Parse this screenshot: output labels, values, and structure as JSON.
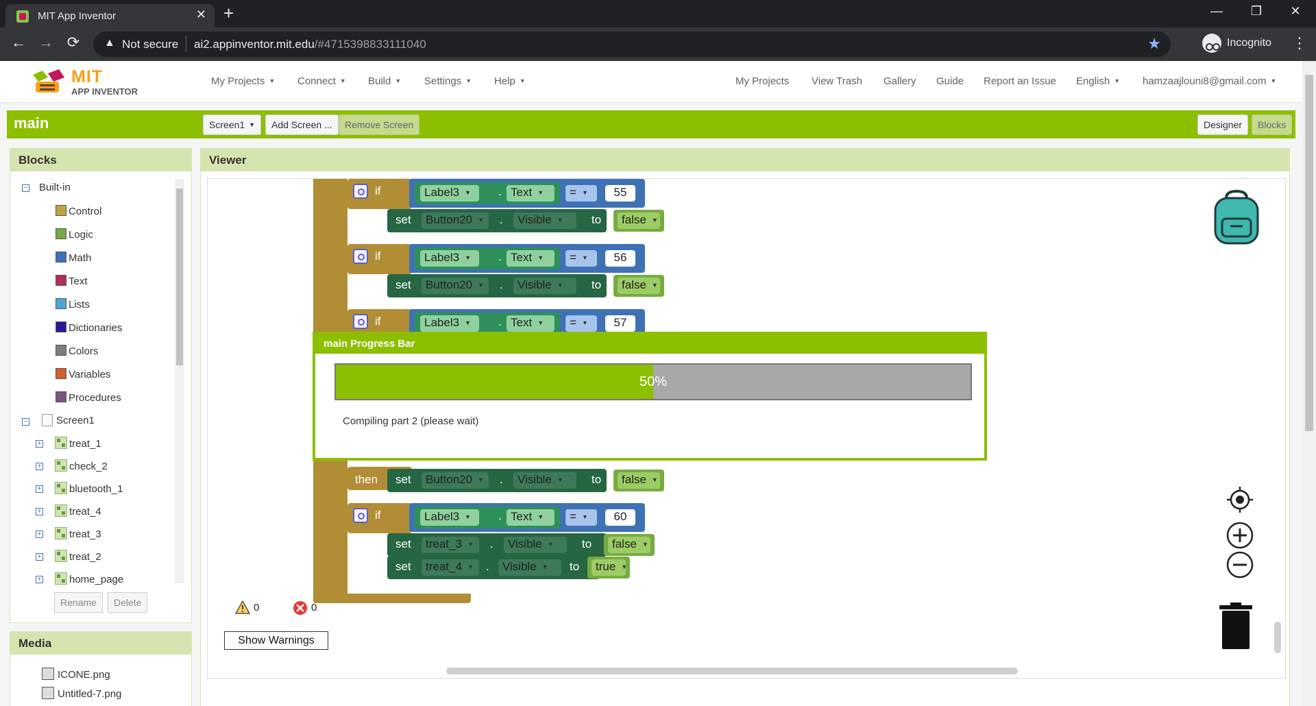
{
  "browser": {
    "tab_title": "MIT App Inventor",
    "tab_close": "✕",
    "new_tab": "+",
    "security_label": "Not secure",
    "url_host": "ai2.appinventor.mit.edu",
    "url_rest": "/#4715398833111040",
    "profile_label": "Incognito",
    "window_controls": [
      "—",
      "❐",
      "✕"
    ],
    "nav": [
      "←",
      "→",
      "⟳"
    ]
  },
  "appnav": {
    "logo_mit": "MIT",
    "logo_sub": "APP INVENTOR",
    "left_menus": [
      "My Projects",
      "Connect",
      "Build",
      "Settings",
      "Help"
    ],
    "right_links": [
      "My Projects",
      "View Trash",
      "Gallery",
      "Guide",
      "Report an Issue",
      "English",
      "hamzaajlouni8@gmail.com"
    ]
  },
  "project_bar": {
    "name": "main",
    "screen_select": "Screen1",
    "add_screen": "Add Screen ...",
    "remove_screen": "Remove Screen",
    "designer": "Designer",
    "blocks": "Blocks"
  },
  "blocks_panel": {
    "title": "Blocks",
    "builtin_label": "Built-in",
    "builtin": [
      {
        "label": "Control",
        "color": "#c0a048"
      },
      {
        "label": "Logic",
        "color": "#77ab41"
      },
      {
        "label": "Math",
        "color": "#3f71b5"
      },
      {
        "label": "Text",
        "color": "#b32d5e"
      },
      {
        "label": "Lists",
        "color": "#49a6d4"
      },
      {
        "label": "Dictionaries",
        "color": "#2d1799"
      },
      {
        "label": "Colors",
        "color": "#7d7d7d"
      },
      {
        "label": "Variables",
        "color": "#d05f2d"
      },
      {
        "label": "Procedures",
        "color": "#7c5385"
      }
    ],
    "screen_label": "Screen1",
    "components": [
      "treat_1",
      "check_2",
      "bluetooth_1",
      "treat_4",
      "treat_3",
      "treat_2",
      "home_page"
    ],
    "rename": "Rename",
    "delete": "Delete"
  },
  "media_panel": {
    "title": "Media",
    "files": [
      "ICONE.png",
      "Untitled-7.png"
    ]
  },
  "viewer": {
    "title": "Viewer",
    "kw_if": "if",
    "kw_then": "then",
    "kw_set": "set",
    "kw_to": "to",
    "dot": ".",
    "label_comp": "Label3",
    "text_prop": "Text",
    "eq_op": "=",
    "visible_prop": "Visible",
    "button_comp": "Button20",
    "val_false": "false",
    "val_true": "true",
    "num_55": "55",
    "num_56": "56",
    "num_57": "57",
    "num_60": "60",
    "treat3": "treat_3",
    "treat4": "treat_4",
    "warnings_count": "0",
    "errors_count": "0",
    "show_warnings": "Show Warnings"
  },
  "progress_dialog": {
    "title": "main Progress Bar",
    "percent_label": "50%",
    "progress": 0.5,
    "message": "Compiling part 2 (please wait)"
  },
  "colors": {
    "accent_green": "#8cbf00",
    "control_block": "#b18e35",
    "math_block": "#3f71b5",
    "component_block": "#266643",
    "logic_block": "#77ab41"
  }
}
